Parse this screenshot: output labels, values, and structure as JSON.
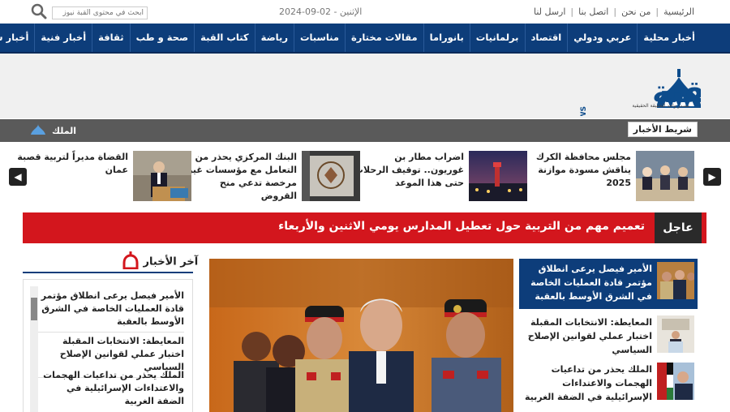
{
  "topbar": {
    "links": [
      "الرئيسية",
      "من نحن",
      "اتصل بنا",
      "ارسل لنا"
    ],
    "date": "الإثنين - 02-09-2024",
    "search_placeholder": "ابحث في محتوى القبة نيوز"
  },
  "nav": {
    "items": [
      "أخبار محلية",
      "عربي ودولي",
      "اقتصاد",
      "برلمانيات",
      "بانوراما",
      "مقالات مختارة",
      "مناسبات",
      "رياضة",
      "كتاب القبة",
      "صحة و طب",
      "ثقافة",
      "أخبار فنية",
      "أخبار ساخنة"
    ]
  },
  "logo": {
    "text": "القبة",
    "news": "NEWS",
    "tagline": "مصدر واحد للحقيقة الحقيقية"
  },
  "ticker": {
    "label": "شريط الأخبار",
    "item": "الملك"
  },
  "cards": [
    {
      "title": "مجلس محافظة الكرك يناقش مسودة موازنة 2025"
    },
    {
      "title": "اضراب مطار بن غوريون.. توقيف الرحلات حتى هذا الموعد"
    },
    {
      "title": "البنك المركزي يحذر من التعامل مع مؤسسات غير مرخصة تدعي منح القروض"
    },
    {
      "title": "القضاة مديراً لتربية قصبة عمان"
    }
  ],
  "breaking": {
    "label": "عاجل",
    "text": "تعميم مهم من التربية حول تعطيل المدارس يومي الاثنين والأربعاء"
  },
  "latest": {
    "title": "آخر الأخبار",
    "items": [
      "الأمير فيصل يرعى انطلاق مؤتمر قادة العمليات الخاصة في الشرق الأوسط بالعقبة",
      "المعايطة: الانتخابات المقبلة اختبار عملي لقوانين الإصلاح السياسي",
      "الملك يحذر من تداعيات الهجمات والاعتداءات الإسرائيلية في الضفة الغربية"
    ]
  },
  "featured": {
    "items": [
      "الأمير فيصل يرعى انطلاق مؤتمر قادة العمليات الخاصة في الشرق الأوسط بالعقبة",
      "المعايطة: الانتخابات المقبلة اختبار عملي لقوانين الإصلاح السياسي",
      "الملك يحذر من تداعيات الهجمات والاعتداءات الإسرائيلية في الضفة الغربية"
    ]
  },
  "colors": {
    "nav": "#0d3d7a",
    "breaking": "#d3161d",
    "ticker": "#5a5a5a"
  }
}
